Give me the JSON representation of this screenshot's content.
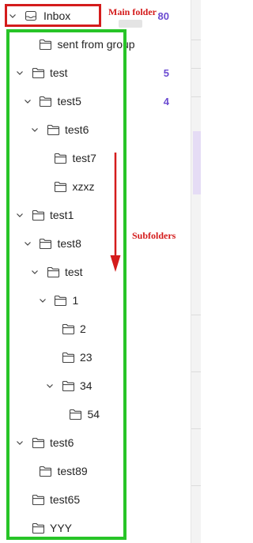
{
  "colors": {
    "accent": "#6b4bd1",
    "annotation_red": "#d41c1c",
    "annotation_green": "#27c427",
    "selection": "#e5dcf5"
  },
  "inbox": {
    "label": "Inbox",
    "count": "80",
    "icon": "inbox-icon"
  },
  "folders": [
    {
      "label": "sent from group",
      "depth": 1,
      "chevron": "none",
      "count": ""
    },
    {
      "label": "test",
      "depth": 0,
      "chevron": "expanded",
      "count": "5"
    },
    {
      "label": "test5",
      "depth": 1,
      "chevron": "expanded",
      "count": "4"
    },
    {
      "label": "test6",
      "depth": 2,
      "chevron": "expanded",
      "count": ""
    },
    {
      "label": "test7",
      "depth": 3,
      "chevron": "none",
      "count": ""
    },
    {
      "label": "xzxz",
      "depth": 3,
      "chevron": "none",
      "count": ""
    },
    {
      "label": "test1",
      "depth": 0,
      "chevron": "expanded",
      "count": ""
    },
    {
      "label": "test8",
      "depth": 1,
      "chevron": "expanded",
      "count": ""
    },
    {
      "label": "test",
      "depth": 2,
      "chevron": "expanded",
      "count": ""
    },
    {
      "label": "1",
      "depth": 3,
      "chevron": "expanded",
      "count": ""
    },
    {
      "label": "2",
      "depth": 4,
      "chevron": "none",
      "count": ""
    },
    {
      "label": "23",
      "depth": 4,
      "chevron": "none",
      "count": ""
    },
    {
      "label": "34",
      "depth": 4,
      "chevron": "expanded",
      "count": ""
    },
    {
      "label": "54",
      "depth": 5,
      "chevron": "none",
      "count": ""
    },
    {
      "label": "test6",
      "depth": 0,
      "chevron": "expanded",
      "count": ""
    },
    {
      "label": "test89",
      "depth": 1,
      "chevron": "none",
      "count": ""
    },
    {
      "label": "test65",
      "depth": 0,
      "chevron": "none",
      "count": ""
    },
    {
      "label": "YYY",
      "depth": 0,
      "chevron": "none",
      "count": ""
    }
  ],
  "annotations": {
    "main_folder": "Main folder",
    "subfolders": "Subfolders"
  }
}
